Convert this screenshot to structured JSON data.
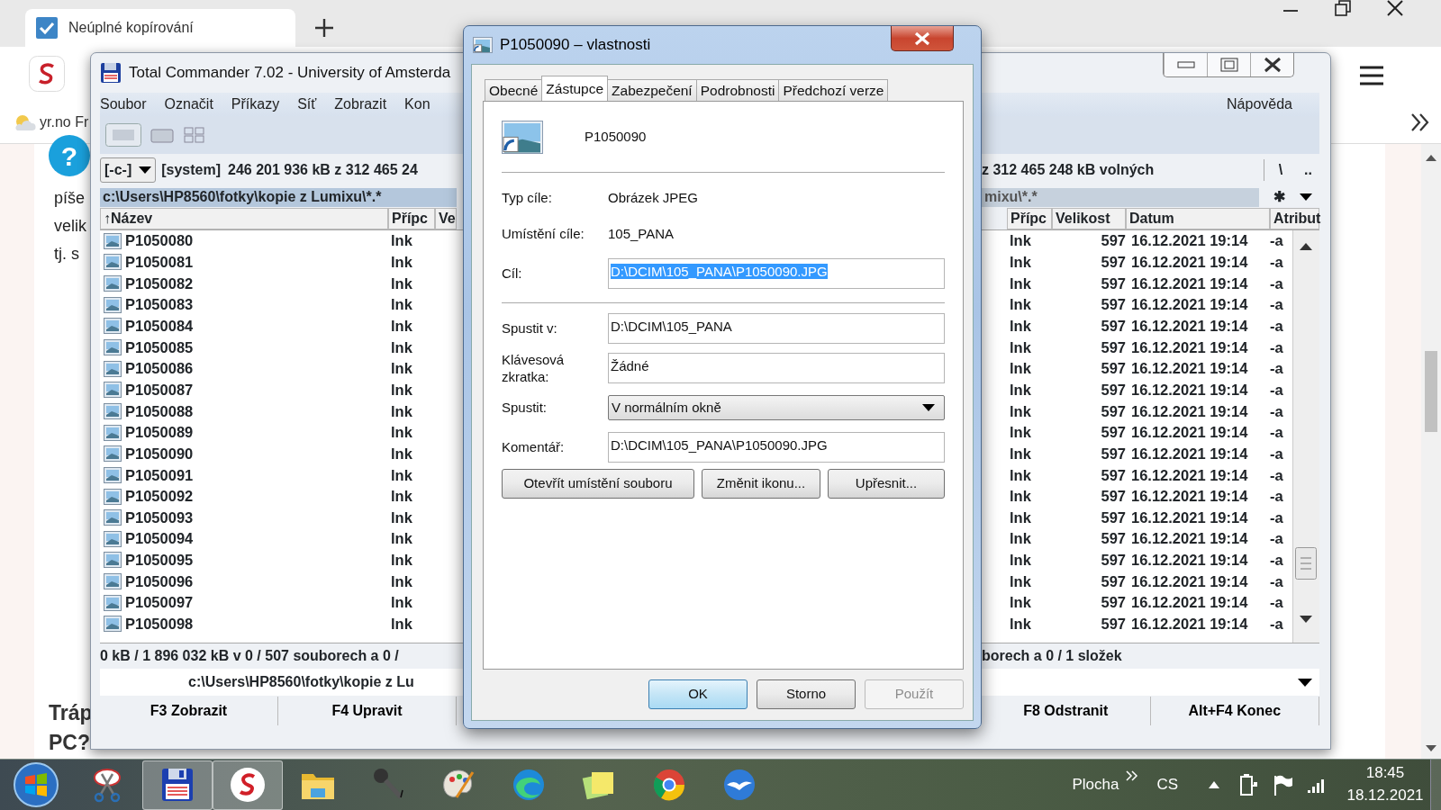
{
  "browser": {
    "tab_title": "Neúplné kopírování",
    "bookmark": "yr.no Fr",
    "help_mark": "?",
    "page_texts": [
      "píše",
      "velik",
      "tj. s"
    ],
    "page_heading": [
      "Tráp",
      "PC?"
    ]
  },
  "total_commander": {
    "title": "Total Commander 7.02 - University of Amsterda",
    "menu": [
      "Soubor",
      "Označit",
      "Příkazy",
      "Síť",
      "Zobrazit",
      "Kon"
    ],
    "menu_right": "Nápověda",
    "left_panel": {
      "active": true,
      "drive": "[-c-]",
      "volume": "[system]",
      "free": "246 201 936 kB z 312 465 24",
      "path": "c:\\Users\\HP8560\\fotky\\kopie z Lumixu\\*.*",
      "columns": [
        "↑Název",
        "Přípc",
        "Ve"
      ],
      "rows": [
        {
          "name": "P1050080",
          "ext": "lnk"
        },
        {
          "name": "P1050081",
          "ext": "lnk"
        },
        {
          "name": "P1050082",
          "ext": "lnk"
        },
        {
          "name": "P1050083",
          "ext": "lnk"
        },
        {
          "name": "P1050084",
          "ext": "lnk"
        },
        {
          "name": "P1050085",
          "ext": "lnk"
        },
        {
          "name": "P1050086",
          "ext": "lnk"
        },
        {
          "name": "P1050087",
          "ext": "lnk"
        },
        {
          "name": "P1050088",
          "ext": "lnk"
        },
        {
          "name": "P1050089",
          "ext": "lnk"
        },
        {
          "name": "P1050090",
          "ext": "lnk"
        },
        {
          "name": "P1050091",
          "ext": "lnk"
        },
        {
          "name": "P1050092",
          "ext": "lnk"
        },
        {
          "name": "P1050093",
          "ext": "lnk"
        },
        {
          "name": "P1050094",
          "ext": "lnk"
        },
        {
          "name": "P1050095",
          "ext": "lnk"
        },
        {
          "name": "P1050096",
          "ext": "lnk"
        },
        {
          "name": "P1050097",
          "ext": "lnk"
        },
        {
          "name": "P1050098",
          "ext": "lnk"
        }
      ],
      "status": "0 kB / 1 896 032 kB v 0 / 507 souborech a 0 /"
    },
    "right_panel": {
      "active": false,
      "free": "z 312 465 248 kB volných",
      "root_button": "\\",
      "up_button": "..",
      "path": "mixu\\*.*",
      "filter_button": "✱",
      "columns": [
        "Přípc",
        "Velikost",
        "Datum",
        "Atribut"
      ],
      "rows": [
        {
          "ext": "lnk",
          "size": "597",
          "date": "16.12.2021 19:14",
          "attr": "-a"
        },
        {
          "ext": "lnk",
          "size": "597",
          "date": "16.12.2021 19:14",
          "attr": "-a"
        },
        {
          "ext": "lnk",
          "size": "597",
          "date": "16.12.2021 19:14",
          "attr": "-a"
        },
        {
          "ext": "lnk",
          "size": "597",
          "date": "16.12.2021 19:14",
          "attr": "-a"
        },
        {
          "ext": "lnk",
          "size": "597",
          "date": "16.12.2021 19:14",
          "attr": "-a"
        },
        {
          "ext": "lnk",
          "size": "597",
          "date": "16.12.2021 19:14",
          "attr": "-a"
        },
        {
          "ext": "lnk",
          "size": "597",
          "date": "16.12.2021 19:14",
          "attr": "-a"
        },
        {
          "ext": "lnk",
          "size": "597",
          "date": "16.12.2021 19:14",
          "attr": "-a"
        },
        {
          "ext": "lnk",
          "size": "597",
          "date": "16.12.2021 19:14",
          "attr": "-a"
        },
        {
          "ext": "lnk",
          "size": "597",
          "date": "16.12.2021 19:14",
          "attr": "-a"
        },
        {
          "ext": "lnk",
          "size": "597",
          "date": "16.12.2021 19:14",
          "attr": "-a"
        },
        {
          "ext": "lnk",
          "size": "597",
          "date": "16.12.2021 19:14",
          "attr": "-a"
        },
        {
          "ext": "lnk",
          "size": "597",
          "date": "16.12.2021 19:14",
          "attr": "-a"
        },
        {
          "ext": "lnk",
          "size": "597",
          "date": "16.12.2021 19:14",
          "attr": "-a"
        },
        {
          "ext": "lnk",
          "size": "597",
          "date": "16.12.2021 19:14",
          "attr": "-a"
        },
        {
          "ext": "lnk",
          "size": "597",
          "date": "16.12.2021 19:14",
          "attr": "-a"
        },
        {
          "ext": "lnk",
          "size": "597",
          "date": "16.12.2021 19:14",
          "attr": "-a"
        },
        {
          "ext": "lnk",
          "size": "597",
          "date": "16.12.2021 19:14",
          "attr": "-a"
        },
        {
          "ext": "lnk",
          "size": "597",
          "date": "16.12.2021 19:14",
          "attr": "-a"
        }
      ],
      "status": "borech a 0 / 1 složek"
    },
    "command_path": "c:\\Users\\HP8560\\fotky\\kopie z Lu",
    "function_keys_left": [
      "F3 Zobrazit",
      "F4 Upravit"
    ],
    "function_keys_right": [
      "F8 Odstranit",
      "Alt+F4 Konec"
    ]
  },
  "dialog": {
    "title": "P1050090 – vlastnosti",
    "tabs": [
      {
        "label": "Obecné",
        "selected": false
      },
      {
        "label": "Zástupce",
        "selected": true
      },
      {
        "label": "Zabezpečení",
        "selected": false
      },
      {
        "label": "Podrobnosti",
        "selected": false
      },
      {
        "label": "Předchozí verze",
        "selected": false
      }
    ],
    "file_name": "P1050090",
    "target_rows": [
      {
        "kind": "text",
        "label": "Typ cíle:",
        "value": "Obrázek JPEG"
      },
      {
        "kind": "text",
        "label": "Umístění cíle:",
        "value": "105_PANA"
      },
      {
        "kind": "field",
        "label": "Cíl:",
        "value": "D:\\DCIM\\105_PANA\\P1050090.JPG",
        "text_selected": true
      }
    ],
    "launch_rows": [
      {
        "kind": "field",
        "label": "Spustit v:",
        "value": "D:\\DCIM\\105_PANA",
        "text_selected": false
      },
      {
        "kind": "field",
        "label": "Klávesová zkratka:",
        "value": "Žádné",
        "text_selected": false
      },
      {
        "kind": "select",
        "label": "Spustit:",
        "value": "V normálním okně"
      },
      {
        "kind": "field",
        "label": "Komentář:",
        "value": "D:\\DCIM\\105_PANA\\P1050090.JPG",
        "text_selected": false
      }
    ],
    "buttons": [
      "Otevřít umístění souboru",
      "Změnit ikonu...",
      "Upřesnit..."
    ],
    "footer_buttons": [
      {
        "label": "OK",
        "default": true,
        "disabled": false
      },
      {
        "label": "Storno",
        "default": false,
        "disabled": false
      },
      {
        "label": "Použít",
        "default": false,
        "disabled": true
      }
    ]
  },
  "taskbar": {
    "apps": [
      {
        "active": false
      },
      {
        "active": true
      },
      {
        "active": true
      },
      {
        "active": false
      },
      {
        "active": false
      },
      {
        "active": false
      },
      {
        "active": false
      },
      {
        "active": false
      },
      {
        "active": false
      },
      {
        "active": false
      }
    ],
    "desktop_label": "Plocha",
    "language": "CS",
    "time": "18:45",
    "date": "18.12.2021"
  }
}
